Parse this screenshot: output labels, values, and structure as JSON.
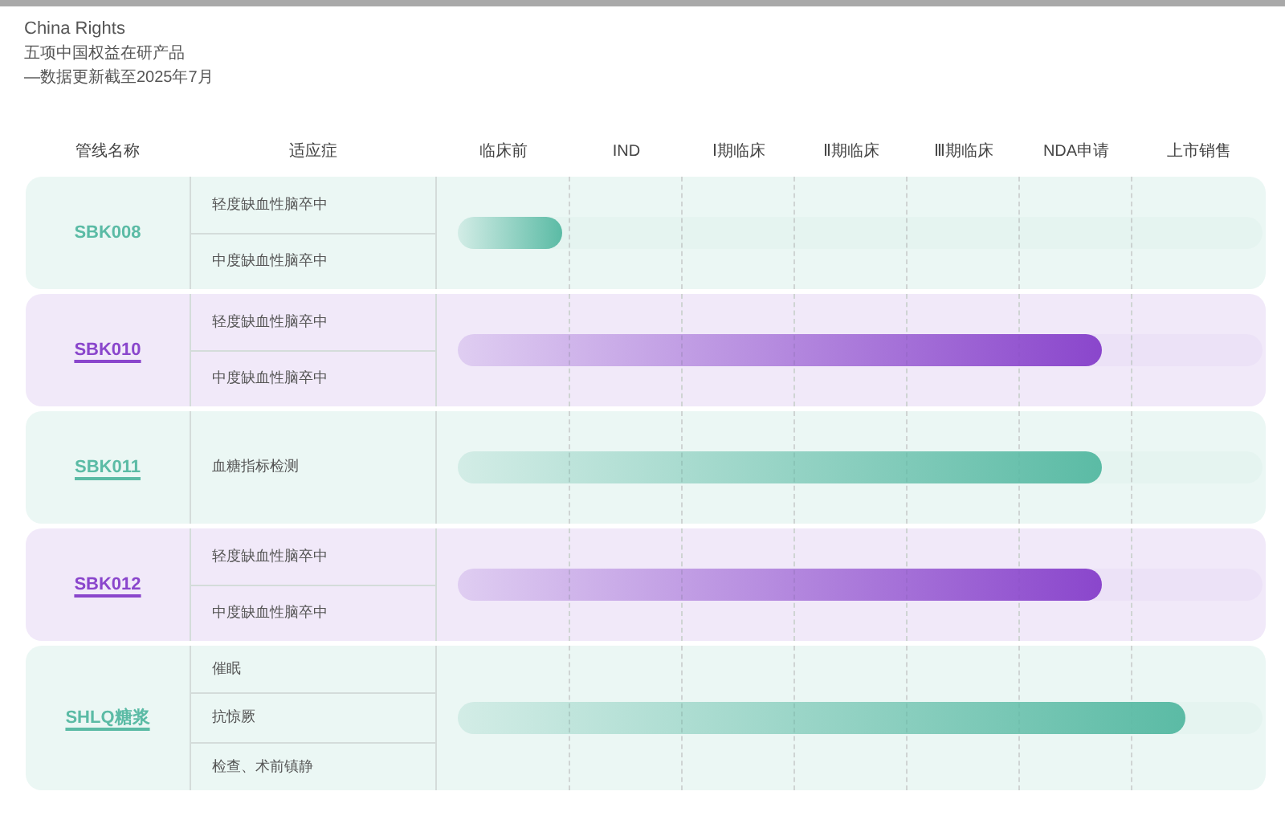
{
  "header": {
    "title": "China Rights",
    "subtitle": "五项中国权益在研产品",
    "note": "—数据更新截至2025年7月"
  },
  "columns": {
    "name": "管线名称",
    "indication": "适应症",
    "stages": [
      "临床前",
      "IND",
      "Ⅰ期临床",
      "Ⅱ期临床",
      "Ⅲ期临床",
      "NDA申请",
      "上市销售"
    ]
  },
  "rows": [
    {
      "name": "SBK008",
      "underlined": false,
      "color": "#5bbba5",
      "level": 0.13,
      "indications": [
        "轻度缺血性脑卒中",
        "中度缺血性脑卒中"
      ]
    },
    {
      "name": "SBK010",
      "underlined": true,
      "color": "#8a46cc",
      "level": 0.8,
      "indications": [
        "轻度缺血性脑卒中",
        "中度缺血性脑卒中"
      ]
    },
    {
      "name": "SBK011",
      "underlined": true,
      "color": "#5bbba5",
      "level": 0.8,
      "indications": [
        "血糖指标检测"
      ]
    },
    {
      "name": "SBK012",
      "underlined": true,
      "color": "#8a46cc",
      "level": 0.8,
      "indications": [
        "轻度缺血性脑卒中",
        "中度缺血性脑卒中"
      ]
    },
    {
      "name": "SHLQ糖浆",
      "underlined": true,
      "color": "#5bbba5",
      "level": 0.905,
      "indications": [
        "催眠",
        "抗惊厥",
        "检查、术前镇静"
      ]
    }
  ]
}
